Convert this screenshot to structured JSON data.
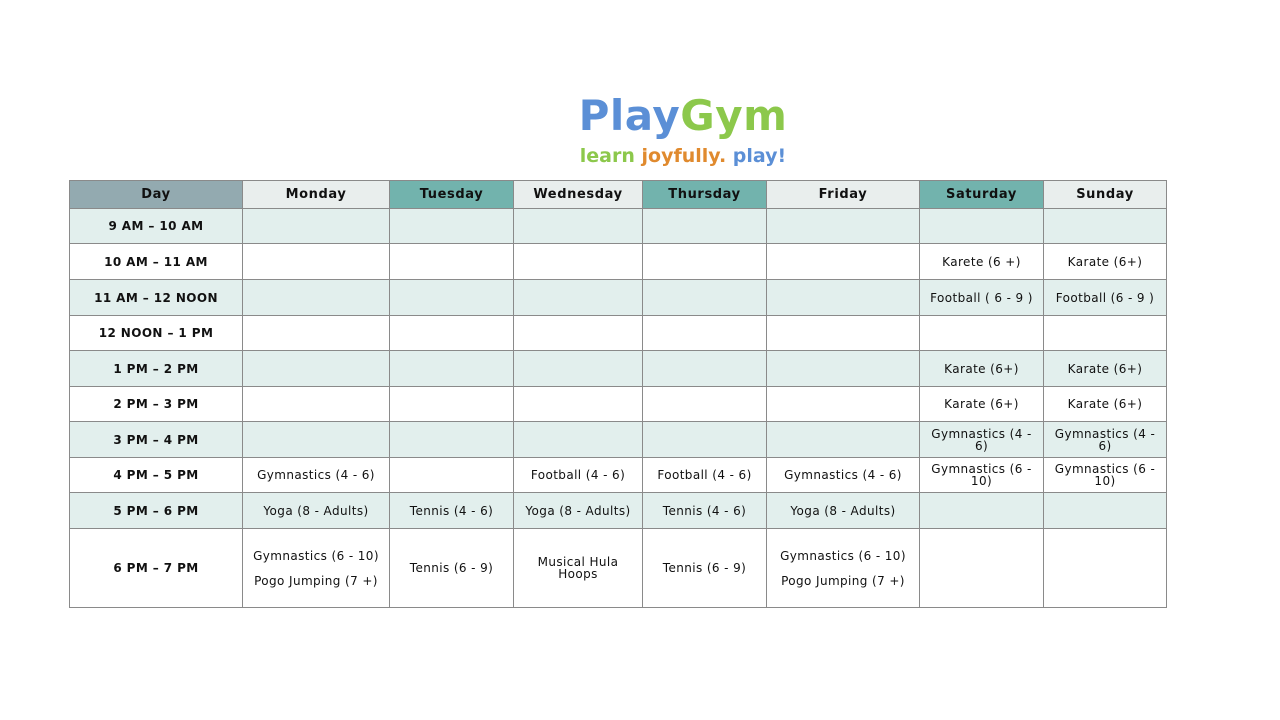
{
  "logo": {
    "play": "Play",
    "gym": "Gym",
    "tagline_1": "learn",
    "tagline_2": "joyfully.",
    "tagline_3": "play!",
    "colors": {
      "blue": "#5b8fd6",
      "green": "#8cc84b",
      "orange": "#e08a2e"
    }
  },
  "schedule": {
    "headers": [
      "Day",
      "Monday",
      "Tuesday",
      "Wednesday",
      "Thursday",
      "Friday",
      "Saturday",
      "Sunday"
    ],
    "rows": [
      {
        "time": "9 AM – 10 AM",
        "cells": [
          "",
          "",
          "",
          "",
          "",
          "",
          ""
        ]
      },
      {
        "time": "10 AM – 11 AM",
        "cells": [
          "",
          "",
          "",
          "",
          "",
          "Karete (6 +)",
          "Karate (6+)"
        ]
      },
      {
        "time": "11 AM – 12 NOON",
        "cells": [
          "",
          "",
          "",
          "",
          "",
          "Football ( 6 - 9 )",
          "Football (6 - 9 )"
        ]
      },
      {
        "time": "12 NOON – 1 PM",
        "cells": [
          "",
          "",
          "",
          "",
          "",
          "",
          ""
        ]
      },
      {
        "time": "1 PM – 2 PM",
        "cells": [
          "",
          "",
          "",
          "",
          "",
          "Karate (6+)",
          "Karate (6+)"
        ]
      },
      {
        "time": "2 PM – 3 PM",
        "cells": [
          "",
          "",
          "",
          "",
          "",
          "Karate (6+)",
          "Karate (6+)"
        ]
      },
      {
        "time": "3 PM – 4 PM",
        "cells": [
          "",
          "",
          "",
          "",
          "",
          "Gymnastics (4 - 6)",
          "Gymnastics (4 - 6)"
        ]
      },
      {
        "time": "4 PM – 5 PM",
        "cells": [
          "Gymnastics (4 - 6)",
          "",
          "Football (4 - 6)",
          "Football (4 - 6)",
          "Gymnastics (4 - 6)",
          "Gymnastics (6 - 10)",
          "Gymnastics (6 - 10)"
        ]
      },
      {
        "time": "5 PM – 6 PM",
        "cells": [
          "Yoga (8 - Adults)",
          "Tennis (4  - 6)",
          "Yoga (8 - Adults)",
          "Tennis (4 - 6)",
          "Yoga (8 - Adults)",
          "",
          ""
        ]
      },
      {
        "time": "6 PM – 7 PM",
        "cells": [
          [
            "Gymnastics (6 - 10)",
            "Pogo Jumping (7 +)"
          ],
          [
            "Tennis (6 - 9)"
          ],
          [
            "Musical Hula",
            "Hoops"
          ],
          [
            "Tennis (6 - 9)"
          ],
          [
            "Gymnastics (6 - 10)",
            "Pogo Jumping (7 +)"
          ],
          [
            ""
          ],
          [
            ""
          ]
        ]
      }
    ]
  }
}
